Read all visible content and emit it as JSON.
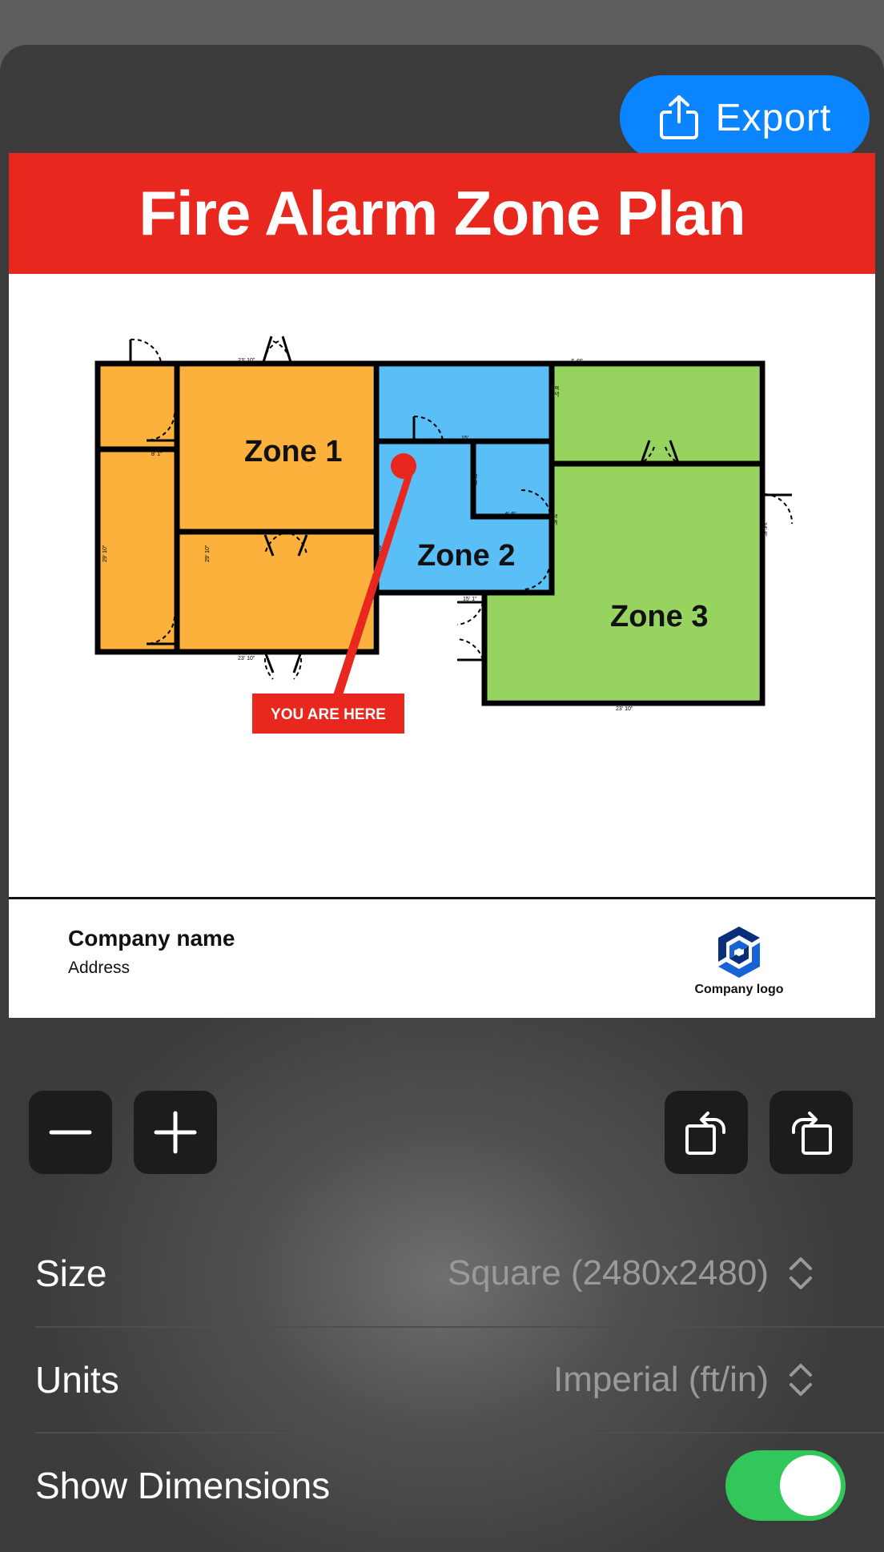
{
  "toolbar": {
    "export_label": "Export"
  },
  "poster": {
    "title": "Fire Alarm Zone Plan",
    "zones": [
      "Zone 1",
      "Zone 2",
      "Zone 3"
    ],
    "you_are_here": "YOU ARE HERE",
    "dimensions": [
      "23' 10\"",
      "8' 1\"",
      "29' 10\"",
      "29' 10\"",
      "29' 10\"",
      "23' 10\"",
      "15'",
      "5' 8\"",
      "6' 8\"",
      "15' 1\"",
      "33' 2\"",
      "8' 5\"",
      "34' 8\"",
      "23' 10\"",
      "5' 8\""
    ],
    "company_name": "Company name",
    "address": "Address",
    "logo_text": "Company logo",
    "colors": {
      "header": "#e8281f",
      "zone1": "#fdb13d",
      "zone2": "#5bbff7",
      "zone3": "#96d45f"
    }
  },
  "settings": {
    "size": {
      "label": "Size",
      "value": "Square (2480x2480)"
    },
    "units": {
      "label": "Units",
      "value": "Imperial (ft/in)"
    },
    "show_dimensions": {
      "label": "Show Dimensions",
      "on": true
    }
  },
  "icons": {
    "zoom_out": "minus-icon",
    "zoom_in": "plus-icon",
    "rotate_left": "rotate-left-icon",
    "rotate_right": "rotate-right-icon",
    "export": "share-icon"
  },
  "colors": {
    "accent": "#0b84ff",
    "toggle_on": "#32c75a"
  }
}
